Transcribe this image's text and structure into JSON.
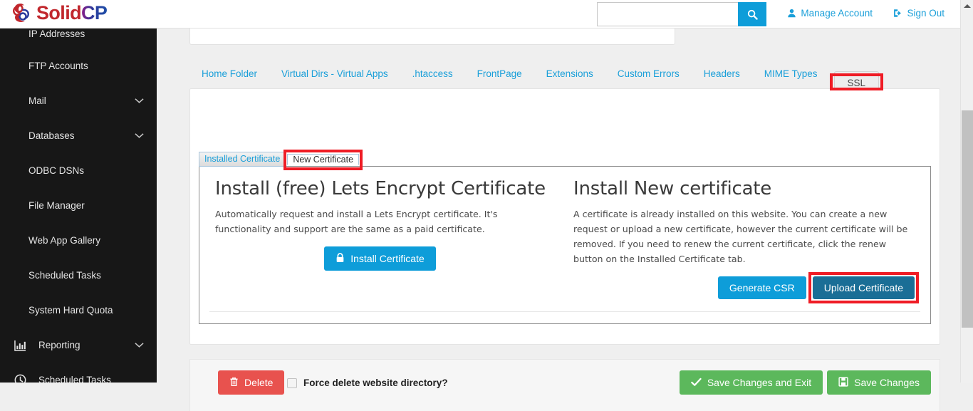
{
  "brand": {
    "name_part1": "Solid",
    "name_part2": "CP",
    "logo_icon": "solidcp-logo-icon",
    "color_red": "#c1272d",
    "color_blue": "#2b3a9c"
  },
  "header": {
    "search_value": "",
    "search_placeholder": "",
    "search_icon": "search-icon",
    "manage_account": "Manage Account",
    "manage_account_icon": "user-icon",
    "sign_out": "Sign Out",
    "sign_out_icon": "sign-out-icon"
  },
  "sidebar": {
    "items": [
      {
        "label": "IP Addresses",
        "icon": "",
        "chevron": false
      },
      {
        "label": "FTP Accounts",
        "icon": "",
        "chevron": false
      },
      {
        "label": "Mail",
        "icon": "",
        "chevron": true
      },
      {
        "label": "Databases",
        "icon": "",
        "chevron": true
      },
      {
        "label": "ODBC DSNs",
        "icon": "",
        "chevron": false
      },
      {
        "label": "File Manager",
        "icon": "",
        "chevron": false
      },
      {
        "label": "Web App Gallery",
        "icon": "",
        "chevron": false
      },
      {
        "label": "Scheduled Tasks",
        "icon": "",
        "chevron": false
      },
      {
        "label": "System Hard Quota",
        "icon": "",
        "chevron": false
      },
      {
        "label": "Reporting",
        "icon": "bar-chart-icon",
        "chevron": true
      },
      {
        "label": "Scheduled Tasks",
        "icon": "clock-icon",
        "chevron": false
      }
    ]
  },
  "tabs": [
    {
      "label": "Home Folder",
      "active": false
    },
    {
      "label": "Virtual Dirs - Virtual Apps",
      "active": false
    },
    {
      "label": ".htaccess",
      "active": false
    },
    {
      "label": "FrontPage",
      "active": false
    },
    {
      "label": "Extensions",
      "active": false
    },
    {
      "label": "Custom Errors",
      "active": false
    },
    {
      "label": "Headers",
      "active": false
    },
    {
      "label": "MIME Types",
      "active": false
    },
    {
      "label": "SSL",
      "active": true
    }
  ],
  "subtabs": [
    {
      "label": "Installed Certificate",
      "active": false
    },
    {
      "label": "New Certificate",
      "active": true
    }
  ],
  "ssl_panel": {
    "left": {
      "heading": "Install (free) Lets Encrypt Certificate",
      "description": "Automatically request and install a Lets Encrypt certificate. It's functionality and support are the same as a paid certificate.",
      "button_label": "Install Certificate",
      "button_icon": "lock-icon",
      "button_color": "#0e9dd9"
    },
    "right": {
      "heading": "Install New certificate",
      "description": "A certificate is already installed on this website. You can create a new request or upload a new certificate, however the current certificate will be removed. If you need to renew the current certificate, click the renew button on the Installed Certificate tab.",
      "generate_csr_label": "Generate CSR",
      "generate_csr_color": "#0e9dd9",
      "upload_certificate_label": "Upload Certificate",
      "upload_certificate_color": "#1a6e96"
    }
  },
  "footer": {
    "delete_label": "Delete",
    "delete_icon": "trash-icon",
    "delete_color": "#e8524e",
    "force_delete_label": "Force delete website directory?",
    "force_delete_checked": false,
    "save_and_exit_label": "Save Changes and Exit",
    "save_and_exit_icon": "check-icon",
    "save_label": "Save Changes",
    "save_icon": "floppy-save-icon",
    "save_color": "#5cb85c"
  },
  "annotations": {
    "highlight_color": "#ef1c25",
    "highlighted": [
      "SSL",
      "New Certificate",
      "Upload Certificate"
    ]
  },
  "scrollbar": {
    "up_arrow_icon": "scroll-up-arrow-icon",
    "thumb": "scrollbar-thumb"
  }
}
